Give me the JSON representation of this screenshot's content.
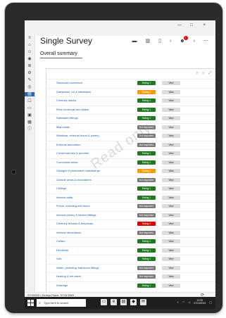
{
  "window": {
    "minimize": "—",
    "maximize": "□",
    "close": "×"
  },
  "app": {
    "title": "Single Survey",
    "section": "Overall summary",
    "watermark": "Read only",
    "badge_count": "1",
    "top_icons": [
      "mail-icon",
      "grid-icon",
      "tablet-icon",
      "more-icon",
      "back-icon",
      "user-icon",
      "forward-icon",
      "overflow-icon"
    ]
  },
  "rows": [
    {
      "label": "Structural movement",
      "status": "Rating 1",
      "color": "#1f7a1f"
    },
    {
      "label": "Dampness, rot & infestation",
      "status": "Rating 2",
      "color": "#f39c12"
    },
    {
      "label": "Chimney stacks",
      "status": "Rating 1",
      "color": "#1f7a1f"
    },
    {
      "label": "Roof coverings and space",
      "status": "Rating 1",
      "color": "#1f7a1f"
    },
    {
      "label": "Rainwater fittings",
      "status": "Rating 1",
      "color": "#1f7a1f"
    },
    {
      "label": "Main walls",
      "status": "Not inspected",
      "color": "#7a7a7a"
    },
    {
      "label": "Windows, external doors & joinery",
      "status": "Not inspected",
      "color": "#7a7a7a"
    },
    {
      "label": "External decoration",
      "status": "Not inspected",
      "color": "#7a7a7a"
    },
    {
      "label": "Conservatories & porches",
      "status": "Rating 1",
      "color": "#1f7a1f"
    },
    {
      "label": "Communal areas",
      "status": "Rating 1",
      "color": "#1f7a1f"
    },
    {
      "label": "Garages & permanent outbuildings",
      "status": "Rating 2",
      "color": "#f39c12"
    },
    {
      "label": "Outside areas & boundaries",
      "status": "Not inspected",
      "color": "#7a7a7a"
    },
    {
      "label": "Ceilings",
      "status": "Rating 1",
      "color": "#1f7a1f"
    },
    {
      "label": "Internal walls",
      "status": "Rating 1",
      "color": "#1f7a1f"
    },
    {
      "label": "Floors, including sub floors",
      "status": "Not inspected",
      "color": "#7a7a7a"
    },
    {
      "label": "Internal joinery & kitchen fittings",
      "status": "Not inspected",
      "color": "#7a7a7a"
    },
    {
      "label": "Chimney breasts & fireplaces",
      "status": "Rating 3",
      "color": "#e00000"
    },
    {
      "label": "Internal decorations",
      "status": "Not inspected",
      "color": "#7a7a7a"
    },
    {
      "label": "Cellars",
      "status": "Rating 1",
      "color": "#1f7a1f"
    },
    {
      "label": "Electricity",
      "status": "Rating 1",
      "color": "#1f7a1f"
    },
    {
      "label": "Gas",
      "status": "Rating 1",
      "color": "#1f7a1f"
    },
    {
      "label": "Water, plumbing, bathroom fittings",
      "status": "Not inspected",
      "color": "#7a7a7a"
    },
    {
      "label": "Heating & hot water",
      "status": "Not inspected",
      "color": "#7a7a7a"
    },
    {
      "label": "Drainage",
      "status": "Rating 1",
      "color": "#1f7a1f"
    }
  ],
  "view_label": "View",
  "status_bar": {
    "address": "SYS0009 • Derbys Place, SY15 5WH"
  },
  "taskbar": {
    "search_placeholder": "Type here to search",
    "time": "12:05",
    "date": "07/10/2019"
  }
}
